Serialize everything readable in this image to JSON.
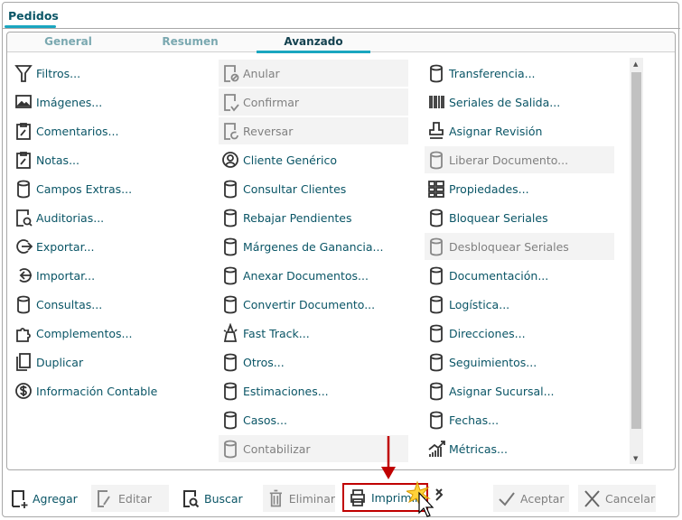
{
  "window_tab": "Pedidos",
  "tabs": [
    {
      "label": "General"
    },
    {
      "label": "Resumen"
    },
    {
      "label": "Avanzado",
      "active": true
    }
  ],
  "columns": [
    [
      {
        "label": "Filtros...",
        "icon": "filter-icon"
      },
      {
        "label": "Imágenes...",
        "icon": "image-icon"
      },
      {
        "label": "Comentarios...",
        "icon": "clipboard-edit-icon"
      },
      {
        "label": "Notas...",
        "icon": "clipboard-edit-icon"
      },
      {
        "label": "Campos Extras...",
        "icon": "database-icon"
      },
      {
        "label": "Auditorias...",
        "icon": "audit-icon"
      },
      {
        "label": "Exportar...",
        "icon": "export-icon"
      },
      {
        "label": "Importar...",
        "icon": "import-icon"
      },
      {
        "label": "Consultas...",
        "icon": "database-icon"
      },
      {
        "label": "Complementos...",
        "icon": "puzzle-icon"
      },
      {
        "label": "Duplicar",
        "icon": "copy-icon"
      },
      {
        "label": "Información Contable",
        "icon": "dollar-icon"
      }
    ],
    [
      {
        "label": "Anular",
        "icon": "doc-cancel-icon",
        "disabled": true
      },
      {
        "label": "Confirmar",
        "icon": "doc-check-icon",
        "disabled": true
      },
      {
        "label": "Reversar",
        "icon": "doc-undo-icon",
        "disabled": true
      },
      {
        "label": "Cliente Genérico",
        "icon": "user-circle-icon"
      },
      {
        "label": "Consultar Clientes",
        "icon": "database-icon"
      },
      {
        "label": "Rebajar Pendientes",
        "icon": "database-icon"
      },
      {
        "label": "Márgenes de Ganancia...",
        "icon": "database-icon"
      },
      {
        "label": "Anexar Documentos...",
        "icon": "database-icon"
      },
      {
        "label": "Convertir Documento...",
        "icon": "database-icon"
      },
      {
        "label": "Fast Track...",
        "icon": "wizard-icon"
      },
      {
        "label": "Otros...",
        "icon": "database-icon"
      },
      {
        "label": "Estimaciones...",
        "icon": "database-icon"
      },
      {
        "label": "Casos...",
        "icon": "database-icon"
      },
      {
        "label": "Contabilizar",
        "icon": "database-icon",
        "disabled": true
      }
    ],
    [
      {
        "label": "Transferencia...",
        "icon": "database-icon"
      },
      {
        "label": "Seriales de Salida...",
        "icon": "barcode-icon"
      },
      {
        "label": "Asignar Revisión",
        "icon": "stamp-icon"
      },
      {
        "label": "Liberar Documento...",
        "icon": "database-icon",
        "disabled": true
      },
      {
        "label": "Propiedades...",
        "icon": "properties-icon"
      },
      {
        "label": "Bloquear Seriales",
        "icon": "database-icon"
      },
      {
        "label": "Desbloquear Seriales",
        "icon": "database-icon",
        "disabled": true
      },
      {
        "label": "Documentación...",
        "icon": "database-icon"
      },
      {
        "label": "Logística...",
        "icon": "database-icon"
      },
      {
        "label": "Direcciones...",
        "icon": "database-icon"
      },
      {
        "label": "Seguimientos...",
        "icon": "database-icon"
      },
      {
        "label": "Asignar Sucursal...",
        "icon": "database-icon"
      },
      {
        "label": "Fechas...",
        "icon": "database-icon"
      },
      {
        "label": "Métricas...",
        "icon": "chart-icon"
      }
    ]
  ],
  "footer": {
    "agregar": "Agregar",
    "editar": "Editar",
    "buscar": "Buscar",
    "eliminar": "Eliminar",
    "imprimir": "Imprimir",
    "aceptar": "Aceptar",
    "cancelar": "Cancelar"
  },
  "colors": {
    "accent": "#1aa6c0",
    "text": "#0a5566",
    "highlight": "#c00000"
  }
}
